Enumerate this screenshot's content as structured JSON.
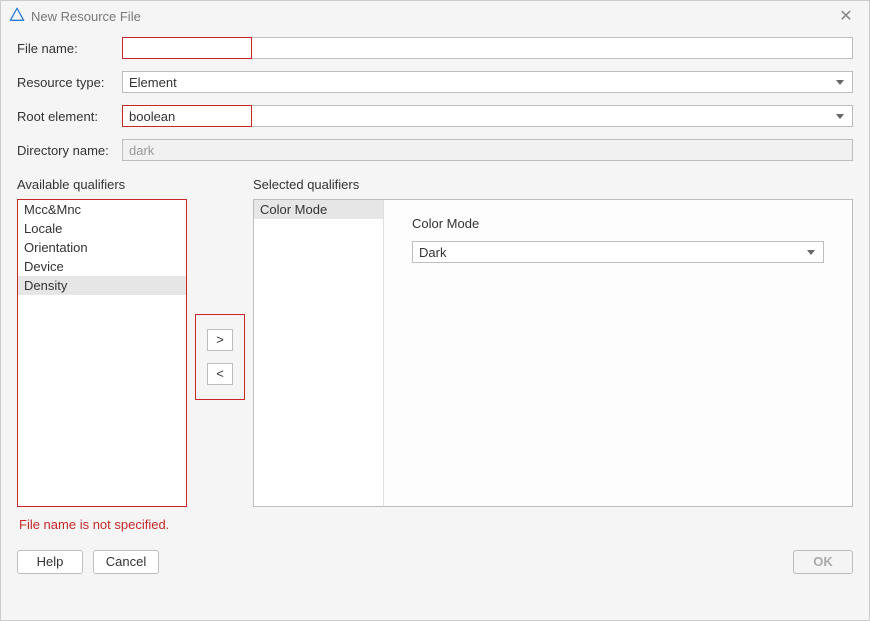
{
  "window": {
    "title": "New Resource File",
    "close_glyph": "✕"
  },
  "form": {
    "file_name_label": "File name:",
    "file_name_value": "",
    "resource_type_label": "Resource type:",
    "resource_type_value": "Element",
    "root_element_label": "Root element:",
    "root_element_value": "boolean",
    "directory_name_label": "Directory name:",
    "directory_name_value": "dark"
  },
  "available": {
    "heading": "Available qualifiers",
    "items": [
      "Mcc&Mnc",
      "Locale",
      "Orientation",
      "Device",
      "Density"
    ],
    "highlight_index": 4
  },
  "transfer": {
    "to_right": ">",
    "to_left": "<"
  },
  "selected": {
    "heading": "Selected qualifiers",
    "items": [
      "Color Mode"
    ],
    "selected_index": 0,
    "detail_label": "Color Mode",
    "detail_value": "Dark"
  },
  "error_message": "File name is not specified.",
  "buttons": {
    "help": "Help",
    "cancel": "Cancel",
    "ok": "OK"
  }
}
